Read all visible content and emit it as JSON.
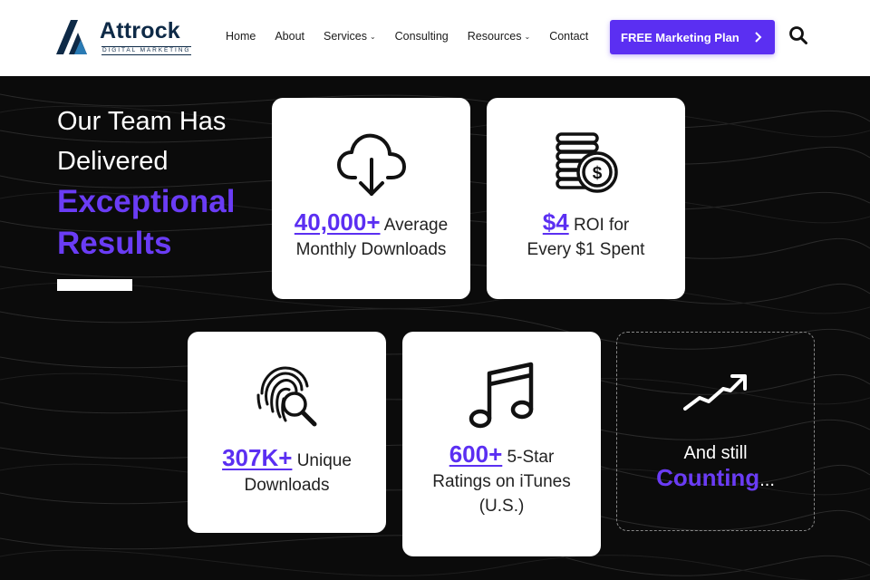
{
  "header": {
    "logo": {
      "name": "Attrock",
      "tagline": "DIGITAL MARKETING"
    },
    "nav": [
      {
        "label": "Home",
        "dropdown": false
      },
      {
        "label": "About",
        "dropdown": false
      },
      {
        "label": "Services",
        "dropdown": true
      },
      {
        "label": "Consulting",
        "dropdown": false
      },
      {
        "label": "Resources",
        "dropdown": true
      },
      {
        "label": "Contact",
        "dropdown": false
      }
    ],
    "cta_label": "FREE Marketing Plan",
    "cta_icon": "chevron-right-icon",
    "search_icon": "search-icon"
  },
  "hero": {
    "heading_line1": "Our Team Has",
    "heading_line2": "Delivered",
    "heading_accent1": "Exceptional",
    "heading_accent2": "Results"
  },
  "cards": {
    "downloads": {
      "icon": "cloud-download-icon",
      "number": "40,000+",
      "text1": "Average",
      "text2": "Monthly Downloads"
    },
    "roi": {
      "icon": "coins-dollar-icon",
      "number": "$4",
      "text1": "ROI for",
      "text2": "Every $1 Spent"
    },
    "unique": {
      "icon": "fingerprint-search-icon",
      "number": "307K+",
      "text1": "Unique",
      "text2": "Downloads"
    },
    "ratings": {
      "icon": "music-note-icon",
      "number": "600+",
      "text1": "5-Star",
      "text2": "Ratings on iTunes",
      "text3": "(U.S.)"
    },
    "counting": {
      "icon": "trending-up-icon",
      "line1": "And still",
      "big": "Counting",
      "suffix": "..."
    }
  },
  "colors": {
    "accent": "#5b2ff2",
    "brand_navy": "#0e2a47",
    "background": "#0b0b0b"
  }
}
